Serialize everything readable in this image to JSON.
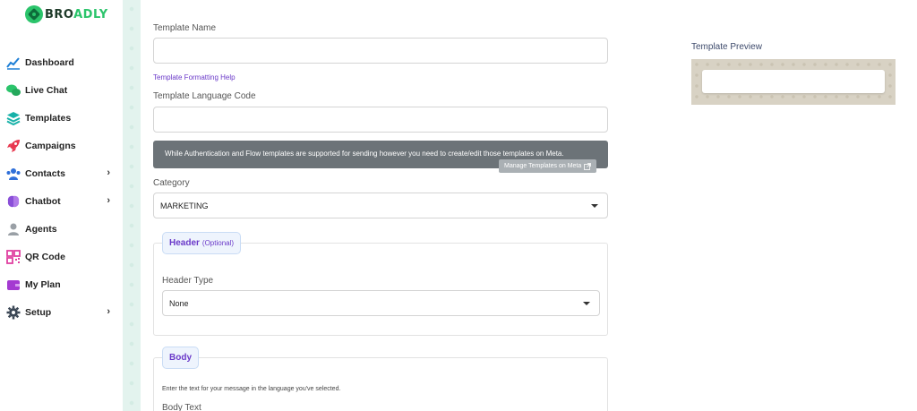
{
  "brand": {
    "name_part1": "BRO",
    "name_part2": "ADLY"
  },
  "sidebar": {
    "items": [
      {
        "label": "Dashboard",
        "icon": "chart-line-icon",
        "color": "#1e7fd6"
      },
      {
        "label": "Live Chat",
        "icon": "chat-bubbles-icon",
        "color": "#2bc46b"
      },
      {
        "label": "Templates",
        "icon": "layers-icon",
        "color": "#17b1a8"
      },
      {
        "label": "Campaigns",
        "icon": "rocket-icon",
        "color": "#e8384f"
      },
      {
        "label": "Contacts",
        "icon": "users-icon",
        "color": "#2f6fd9",
        "chevron": "›"
      },
      {
        "label": "Chatbot",
        "icon": "brain-icon",
        "color": "#8a4fd8",
        "chevron": "›"
      },
      {
        "label": "Agents",
        "icon": "agent-icon",
        "color": "#9aa0a6"
      },
      {
        "label": "QR Code",
        "icon": "qr-code-icon",
        "color": "#e040a0"
      },
      {
        "label": "My Plan",
        "icon": "wallet-icon",
        "color": "#a43ad1"
      },
      {
        "label": "Setup",
        "icon": "gear-icon",
        "color": "#3a4654",
        "chevron": "›"
      }
    ]
  },
  "form": {
    "template_name_label": "Template Name",
    "template_name_value": "",
    "formatting_help_link": "Template Formatting Help",
    "language_code_label": "Template Language Code",
    "language_code_value": "",
    "alert_text": "While Authentication and Flow templates are supported for sending however you need to create/edit those templates on Meta.",
    "alert_button": "Manage Templates on Meta",
    "category_label": "Category",
    "category_value": "MARKETING",
    "header_section": {
      "title": "Header",
      "optional": "(Optional)",
      "type_label": "Header Type",
      "type_value": "None"
    },
    "body_section": {
      "title": "Body",
      "help_text": "Enter the text for your message in the language you've selected.",
      "body_text_label": "Body Text"
    }
  },
  "preview": {
    "title": "Template Preview"
  },
  "colors": {
    "accent": "#6b3ac9",
    "brand_green": "#2bc46b",
    "alert_bg": "#6c7378"
  }
}
